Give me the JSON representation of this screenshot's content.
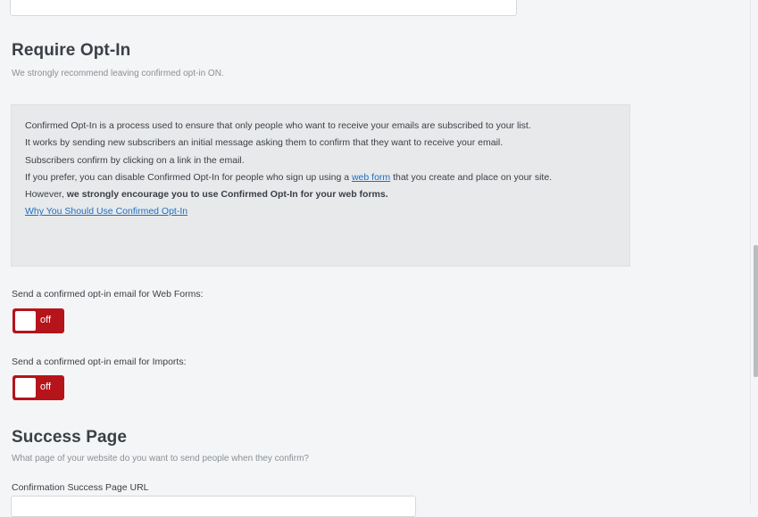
{
  "require_optin": {
    "heading": "Require Opt-In",
    "subtitle": "We strongly recommend leaving confirmed opt-in ON."
  },
  "info": {
    "line1": "Confirmed Opt-In is a process used to ensure that only people who want to receive your emails are subscribed to your list.",
    "line2": "It works by sending new subscribers an initial message asking them to confirm that they want to receive your email.",
    "line3": "Subscribers confirm by clicking on a link in the email.",
    "line4_before": "If you prefer, you can disable Confirmed Opt-In for people who sign up using a ",
    "line4_link": "web form",
    "line4_after": " that you create and place on your site.",
    "line5_before": "However, ",
    "line5_bold": "we strongly encourage you to use Confirmed Opt-In for your web forms.",
    "why_link": "Why You Should Use Confirmed Opt-In"
  },
  "web_forms": {
    "label": "Send a confirmed opt-in email for Web Forms:",
    "toggle_state": "off"
  },
  "imports": {
    "label": "Send a confirmed opt-in email for Imports:",
    "toggle_state": "off"
  },
  "success_page": {
    "heading": "Success Page",
    "subtitle": "What page of your website do you want to send people when they confirm?",
    "url_label": "Confirmation Success Page URL",
    "url_value": ""
  },
  "colors": {
    "toggle_off": "#b5141b",
    "link": "#1f6fc1"
  }
}
